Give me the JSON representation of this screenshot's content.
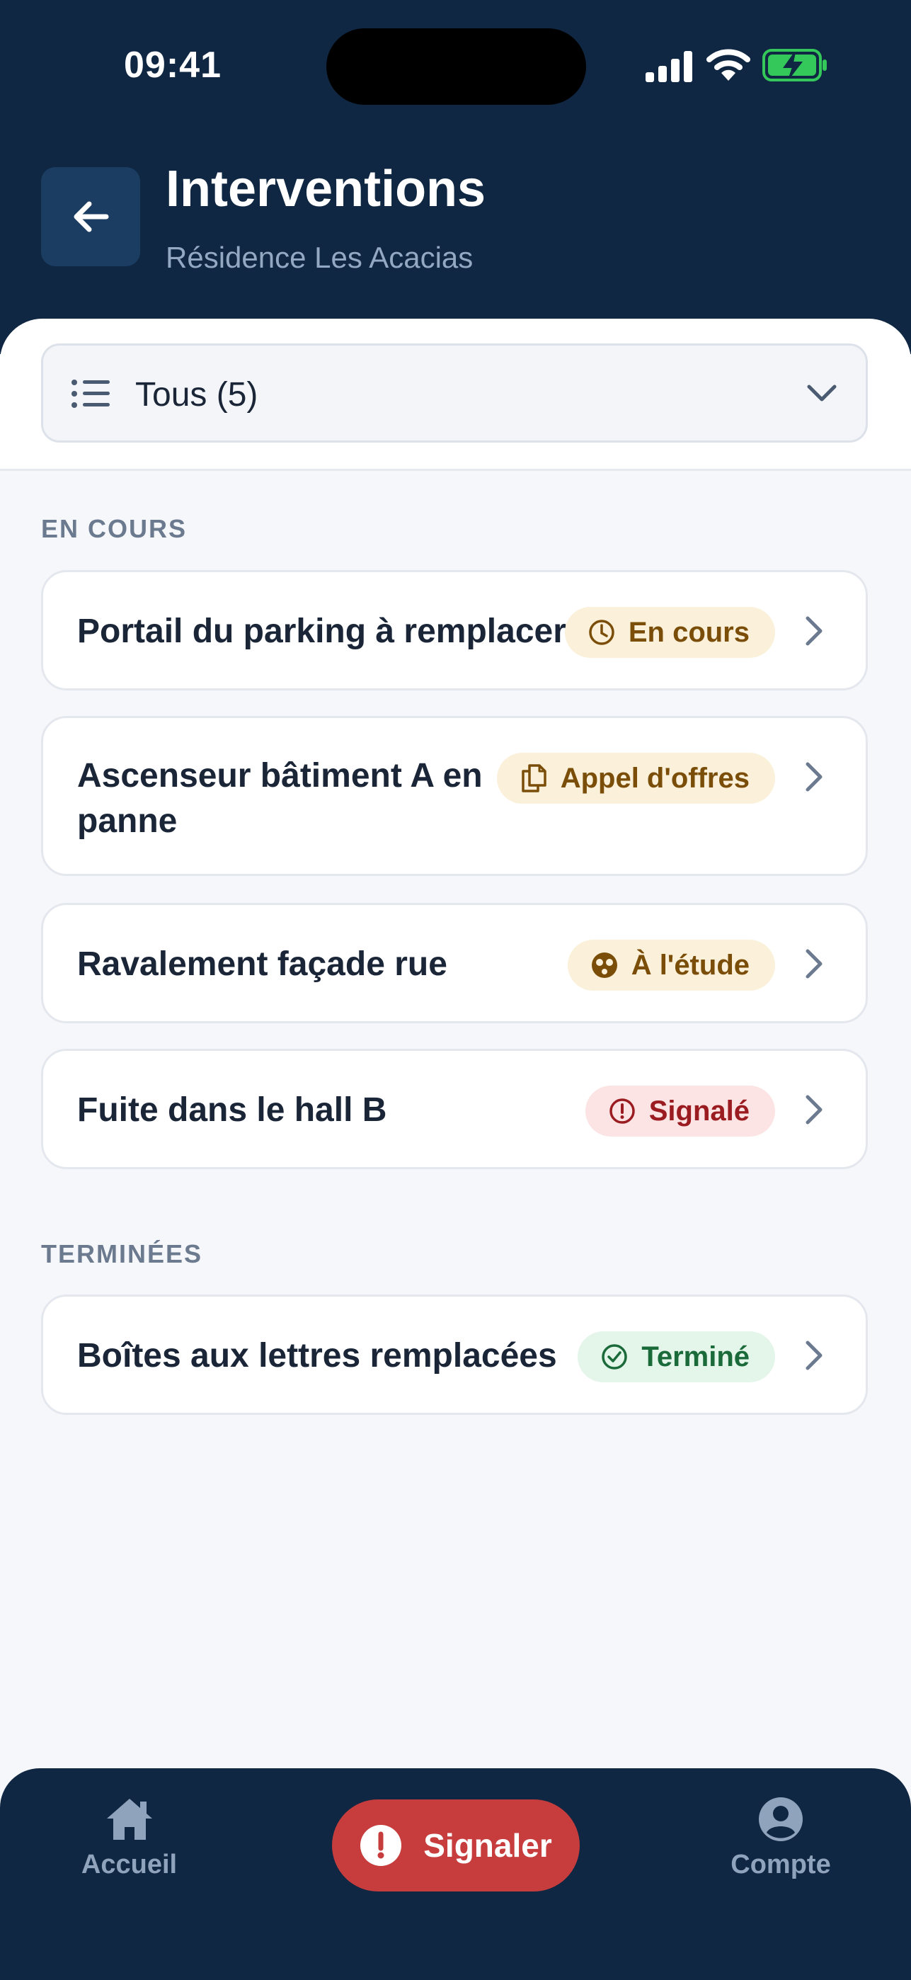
{
  "status_bar": {
    "time": "09:41"
  },
  "header": {
    "title": "Interventions",
    "subtitle": "Résidence Les Acacias"
  },
  "filter": {
    "label": "Tous (5)"
  },
  "sections": [
    {
      "label": "EN COURS",
      "items": [
        {
          "title": "Portail du parking à remplacer",
          "status": "En cours",
          "status_icon": "clock-icon",
          "status_color": "#7a4e08"
        },
        {
          "title_line1": "Ascenseur bâtiment A en",
          "title_line2": "panne",
          "status": "Appel d'offres",
          "status_icon": "documents-icon",
          "status_color": "#7a4e08"
        },
        {
          "title": "Ravalement façade rue",
          "status": "À l'étude",
          "status_icon": "study-icon",
          "status_color": "#7a4e08"
        },
        {
          "title": "Fuite dans le hall B",
          "status": "Signalé",
          "status_icon": "alert-circle-icon",
          "status_color": "#9b1c20"
        }
      ]
    },
    {
      "label": "TERMINÉES",
      "items": [
        {
          "title": "Boîtes aux lettres remplacées",
          "status": "Terminé",
          "status_icon": "check-circle-icon",
          "status_color": "#1b6b3a"
        }
      ]
    }
  ],
  "bottom_nav": {
    "home_label": "Accueil",
    "report_label": "Signaler",
    "account_label": "Compte"
  },
  "colors": {
    "header_bg": "#0f2742",
    "accent_red": "#c73d3d",
    "amber_badge_bg": "#fbf0d9",
    "red_badge_bg": "#fce4e4",
    "green_badge_bg": "#e4f5ea"
  }
}
